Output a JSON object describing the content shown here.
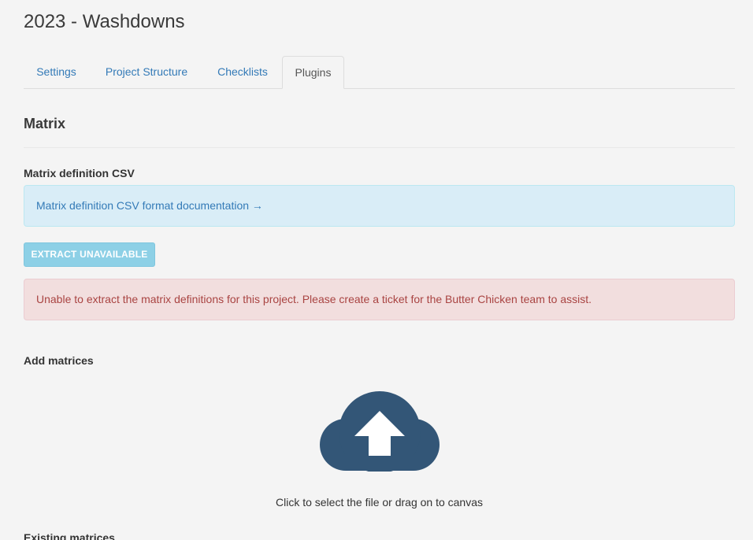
{
  "page": {
    "title": "2023 - Washdowns"
  },
  "tabs": [
    {
      "label": "Settings",
      "active": false
    },
    {
      "label": "Project Structure",
      "active": false
    },
    {
      "label": "Checklists",
      "active": false
    },
    {
      "label": "Plugins",
      "active": true
    }
  ],
  "matrix": {
    "section_title": "Matrix",
    "definition_label": "Matrix definition CSV",
    "doc_link": "Matrix definition CSV format documentation →",
    "extract_button": "EXTRACT UNAVAILABLE",
    "error_message": "Unable to extract the matrix definitions for this project. Please create a ticket for the Butter Chicken team to assist.",
    "add_label": "Add matrices",
    "dropzone_text": "Click to select the file or drag on to canvas",
    "existing_label": "Existing matrices"
  },
  "colors": {
    "link": "#337ab7",
    "info_bg": "#d9edf7",
    "danger_bg": "#f2dede",
    "danger_text": "#a94442",
    "button_disabled": "#8dd0e6",
    "upload_icon": "#335677"
  },
  "icons": {
    "upload": "cloud-upload-icon"
  }
}
